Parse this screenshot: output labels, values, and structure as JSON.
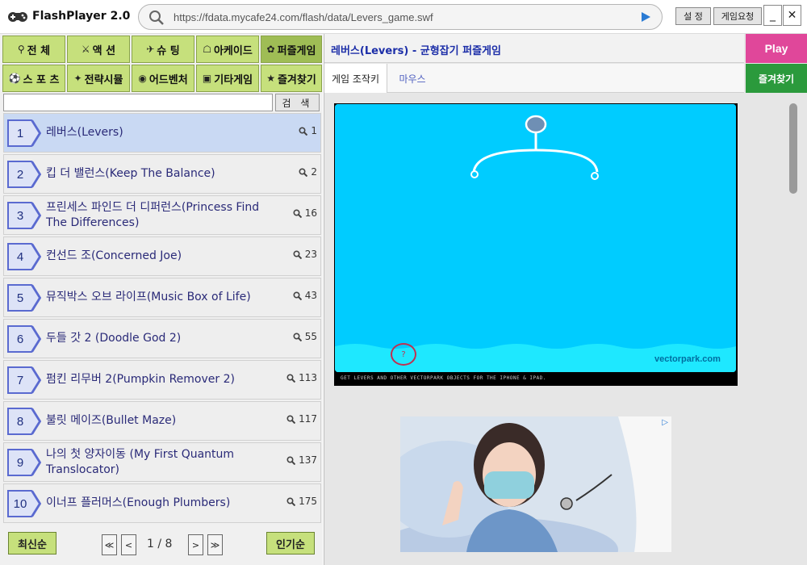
{
  "app": {
    "title": "FlashPlayer 2.0"
  },
  "url": {
    "value": "https://fdata.mycafe24.com/flash/data/Levers_game.swf"
  },
  "toolbar": {
    "settings_label": "설 정",
    "request_label": "게임요청",
    "minimize_label": "_",
    "close_label": "✕"
  },
  "categories": [
    {
      "label": "전 체",
      "icon": "key-icon"
    },
    {
      "label": "액 션",
      "icon": "swords-icon"
    },
    {
      "label": "슈 팅",
      "icon": "target-icon"
    },
    {
      "label": "아케이드",
      "icon": "gamepad-icon"
    },
    {
      "label": "퍼즐게임",
      "icon": "puzzle-icon"
    },
    {
      "label": "스 포 츠",
      "icon": "ball-icon"
    },
    {
      "label": "전략시뮬",
      "icon": "strategy-icon"
    },
    {
      "label": "어드벤처",
      "icon": "globe-icon"
    },
    {
      "label": "기타게임",
      "icon": "box-icon"
    },
    {
      "label": "즐겨찾기",
      "icon": "star-icon"
    }
  ],
  "search": {
    "placeholder": "",
    "button_label": "검 색"
  },
  "games": [
    {
      "rank": "1",
      "title": "레버스(Levers)",
      "plays": "1"
    },
    {
      "rank": "2",
      "title": "킵 더 밸런스(Keep The Balance)",
      "plays": "2"
    },
    {
      "rank": "3",
      "title": "프린세스 파인드 더 디퍼런스(Princess Find The Differences)",
      "plays": "16"
    },
    {
      "rank": "4",
      "title": "컨선드 조(Concerned Joe)",
      "plays": "23"
    },
    {
      "rank": "5",
      "title": "뮤직박스 오브 라이프(Music Box of Life)",
      "plays": "43"
    },
    {
      "rank": "6",
      "title": "두들 갓 2 (Doodle God 2)",
      "plays": "55"
    },
    {
      "rank": "7",
      "title": "펌킨 리무버 2(Pumpkin Remover 2)",
      "plays": "113"
    },
    {
      "rank": "8",
      "title": "불릿 메이즈(Bullet Maze)",
      "plays": "117"
    },
    {
      "rank": "9",
      "title": "나의 첫 양자이동 (My First Quantum Translocator)",
      "plays": "137"
    },
    {
      "rank": "10",
      "title": "이너프 플러머스(Enough Plumbers)",
      "plays": "175"
    }
  ],
  "pagination": {
    "latest_label": "최신순",
    "popular_label": "인기순",
    "first": "≪",
    "prev": "<",
    "next": ">",
    "last": "≫",
    "page_text": "1 / 8"
  },
  "game": {
    "title": "레버스(Levers) - 균형잡기 퍼즐게임",
    "play_label": "Play",
    "favorite_label": "즐겨찾기",
    "tabs": [
      {
        "label": "게임 조작키"
      },
      {
        "label": "마우스"
      }
    ],
    "footer_text": "GET LEVERS AND OTHER VECTORPARK OBJECTS FOR THE IPHONE & IPAD.",
    "logo_text": "vectorpark.com",
    "help_symbol": "?"
  },
  "colors": {
    "category_bg": "#c6e07c",
    "play_bg": "#e0479a",
    "favorite_bg": "#2b9a3c",
    "game_bg": "#00ccff",
    "selected_row": "#c9d9f3"
  }
}
